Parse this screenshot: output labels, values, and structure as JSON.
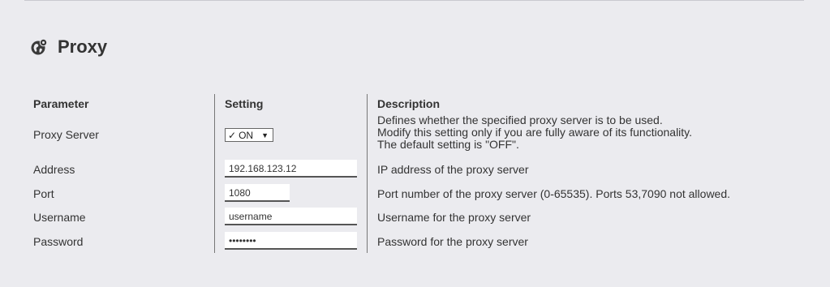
{
  "section": {
    "title": "Proxy",
    "icon": "globe-gear-icon"
  },
  "table": {
    "headers": {
      "parameter": "Parameter",
      "setting": "Setting",
      "description": "Description"
    },
    "rows": {
      "proxy_server": {
        "label": "Proxy Server",
        "select_check": "✓",
        "select_value": "ON",
        "select_caret": "▼",
        "description": [
          "Defines whether the specified proxy server is to be used.",
          "Modify this setting only if you are fully aware of its functionality.",
          "The default setting is \"OFF\"."
        ]
      },
      "address": {
        "label": "Address",
        "value": "192.168.123.12",
        "description": "IP address of the proxy server"
      },
      "port": {
        "label": "Port",
        "value": "1080",
        "description": "Port number of the proxy server (0-65535). Ports 53,7090 not allowed."
      },
      "username": {
        "label": "Username",
        "value": "username",
        "description": "Username for the proxy server"
      },
      "password": {
        "label": "Password",
        "value": "••••••••",
        "description": "Password for the proxy server"
      }
    }
  }
}
